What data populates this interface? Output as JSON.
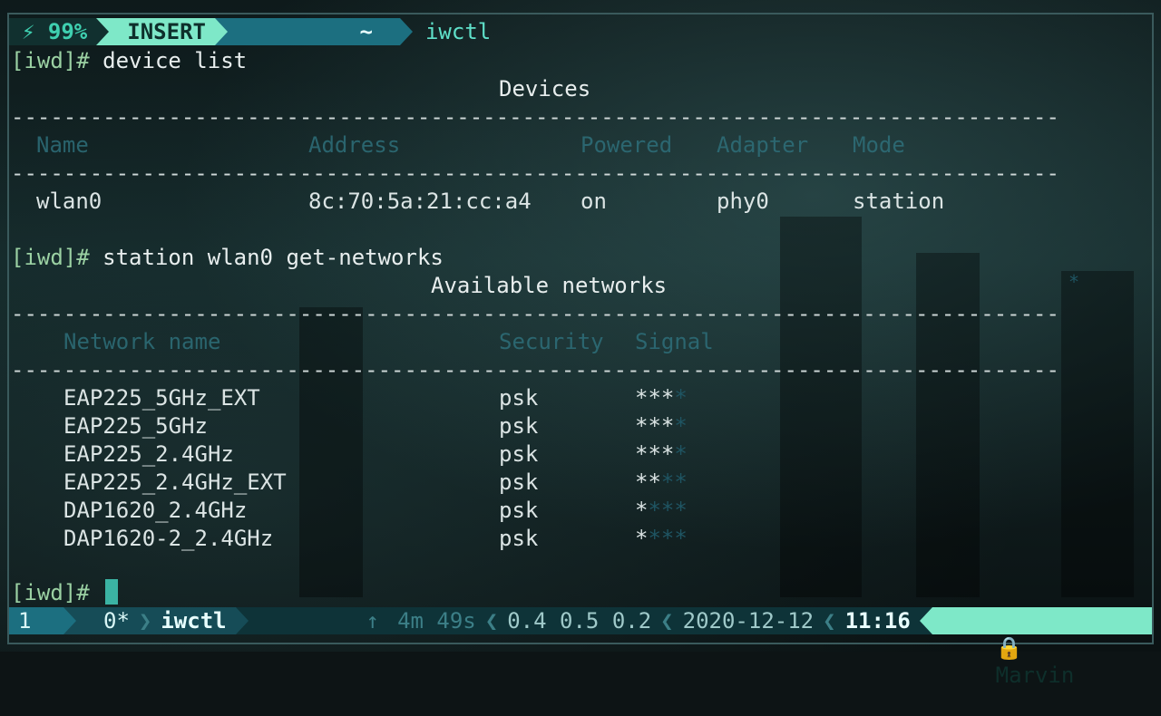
{
  "top_status": {
    "battery_icon": "lightning-icon",
    "battery": "99%",
    "mode": "INSERT",
    "directory": "~",
    "program": "iwctl"
  },
  "session": {
    "prompt": "[iwd]#",
    "command1": "device list",
    "devices_title": "Devices",
    "dash_line": "--------------------------------------------------------------------------------",
    "device_headers": [
      "Name",
      "Address",
      "Powered",
      "Adapter",
      "Mode"
    ],
    "devices": [
      {
        "name": "wlan0",
        "address": "8c:70:5a:21:cc:a4",
        "powered": "on",
        "adapter": "phy0",
        "mode": "station"
      }
    ],
    "command2": "station wlan0 get-networks",
    "networks_title": "Available networks",
    "network_headers": [
      "Network name",
      "Security",
      "Signal"
    ],
    "networks": [
      {
        "name": "EAP225_5GHz_EXT",
        "security": "psk",
        "signal_lit": "***",
        "signal_dim": "*"
      },
      {
        "name": "EAP225_5GHz",
        "security": "psk",
        "signal_lit": "***",
        "signal_dim": "*"
      },
      {
        "name": "EAP225_2.4GHz",
        "security": "psk",
        "signal_lit": "***",
        "signal_dim": "*"
      },
      {
        "name": "EAP225_2.4GHz_EXT",
        "security": "psk",
        "signal_lit": "**",
        "signal_dim": "**"
      },
      {
        "name": "DAP1620_2.4GHz",
        "security": "psk",
        "signal_lit": "*",
        "signal_dim": "***"
      },
      {
        "name": "DAP1620-2_2.4GHz",
        "security": "psk",
        "signal_lit": "*",
        "signal_dim": "***"
      }
    ],
    "star_glyph": "*"
  },
  "bottom_status": {
    "session_num": "1",
    "window0": "0*",
    "window1": "iwctl",
    "elapsed_icon": "up-arrow-icon",
    "elapsed": "4m 49s",
    "load": "0.4 0.5 0.2",
    "date": "2020-12-12",
    "time": "11:16",
    "lock_icon": "lock-icon",
    "user": "Marvin"
  },
  "colors": {
    "accent": "#7ee8c8",
    "prompt": "#9bd1a3",
    "header_dim": "#2e6f7a"
  }
}
